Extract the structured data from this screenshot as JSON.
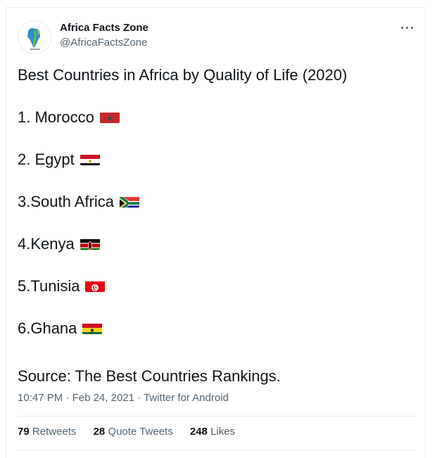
{
  "account": {
    "name": "Africa Facts Zone",
    "handle": "@AfricaFactsZone"
  },
  "tweet": {
    "title": "Best Countries in Africa by Quality of Life (2020)",
    "items": [
      {
        "label": "1. Morocco",
        "flag": "morocco-flag"
      },
      {
        "label": "2. Egypt",
        "flag": "egypt-flag"
      },
      {
        "label": "3.South Africa",
        "flag": "south-africa-flag"
      },
      {
        "label": "4.Kenya",
        "flag": "kenya-flag"
      },
      {
        "label": "5.Tunisia",
        "flag": "tunisia-flag"
      },
      {
        "label": "6.Ghana",
        "flag": "ghana-flag"
      }
    ],
    "source": "Source: The Best Countries Rankings."
  },
  "meta": {
    "time": "10:47 PM",
    "sep1": " · ",
    "date": "Feb 24, 2021",
    "sep2": " · ",
    "client": "Twitter for Android"
  },
  "stats": {
    "retweets_count": "79",
    "retweets_label": "Retweets",
    "quotes_count": "28",
    "quotes_label": "Quote Tweets",
    "likes_count": "248",
    "likes_label": "Likes"
  },
  "colors": {
    "text": "#0f1419",
    "secondary": "#536471",
    "border": "#e6ecf0"
  }
}
